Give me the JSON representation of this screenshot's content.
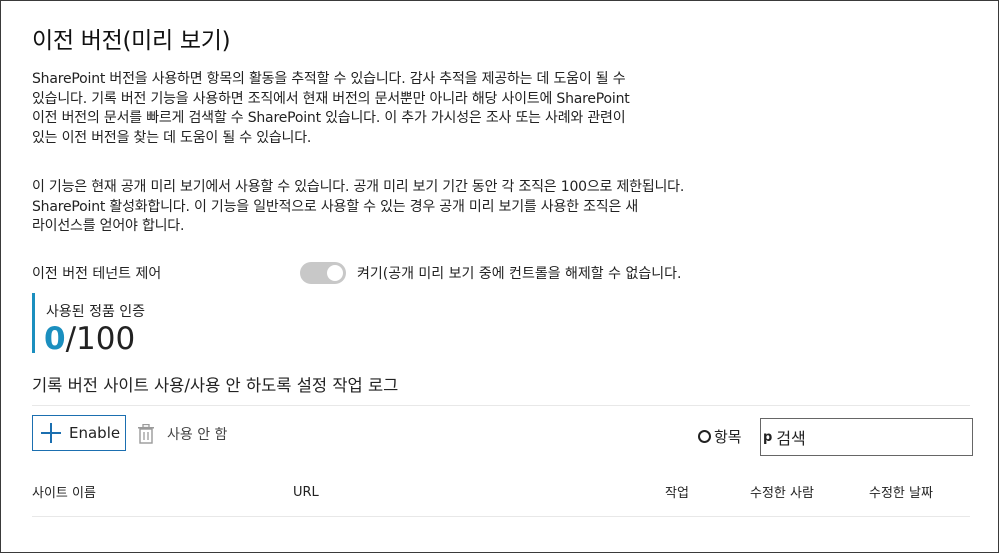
{
  "page": {
    "title": "이전 버전(미리 보기)"
  },
  "description": {
    "paragraph1": [
      "SharePoint 버전을 사용하면 항목의 활동을 추적할 수 있습니다. 감사 추적을 제공하는 데 도움이 될 수",
      "있습니다. 기록 버전 기능을 사용하면 조직에서 현재 버전의 문서뿐만 아니라 해당 사이트에 SharePoint",
      "이전 버전의 문서를 빠르게 검색할 수 SharePoint 있습니다. 이 추가 가시성은 조사 또는 사례와 관련이",
      "있는 이전 버전을 찾는 데 도움이 될 수 있습니다."
    ],
    "paragraph2": [
      "이 기능은 현재 공개 미리 보기에서 사용할 수 있습니다. 공개 미리 보기 기간 동안 각 조직은 100으로 제한됩니다.",
      "SharePoint 활성화합니다. 이 기능을 일반적으로 사용할 수 있는 경우 공개 미리 보기를 사용한 조직은 새",
      "라이선스를 얻어야 합니다."
    ]
  },
  "tenant_control": {
    "label": "이전 버전 테넌트 제어",
    "toggle_state": "on",
    "toggle_text": "켜기(공개 미리 보기 중에 컨트롤을 해제할 수 없습니다."
  },
  "licenses": {
    "label": "사용된 정품 인증",
    "used": "0",
    "total": "/100"
  },
  "log": {
    "title": "기록 버전 사이트 사용/사용 안 하도록 설정 작업 로그"
  },
  "toolbar": {
    "enable_label": "Enable",
    "disable_label": "사용 안 함",
    "items_label": "항목",
    "search_icon_glyph": "p",
    "search_placeholder": "검색"
  },
  "table": {
    "columns": [
      "사이트 이름",
      "URL",
      "작업",
      "수정한 사람",
      "수정한 날짜"
    ]
  },
  "colors": {
    "accent": "#1b8fbf",
    "button_border": "#1b6fb0",
    "toggle_off": "#c8c8c8"
  }
}
